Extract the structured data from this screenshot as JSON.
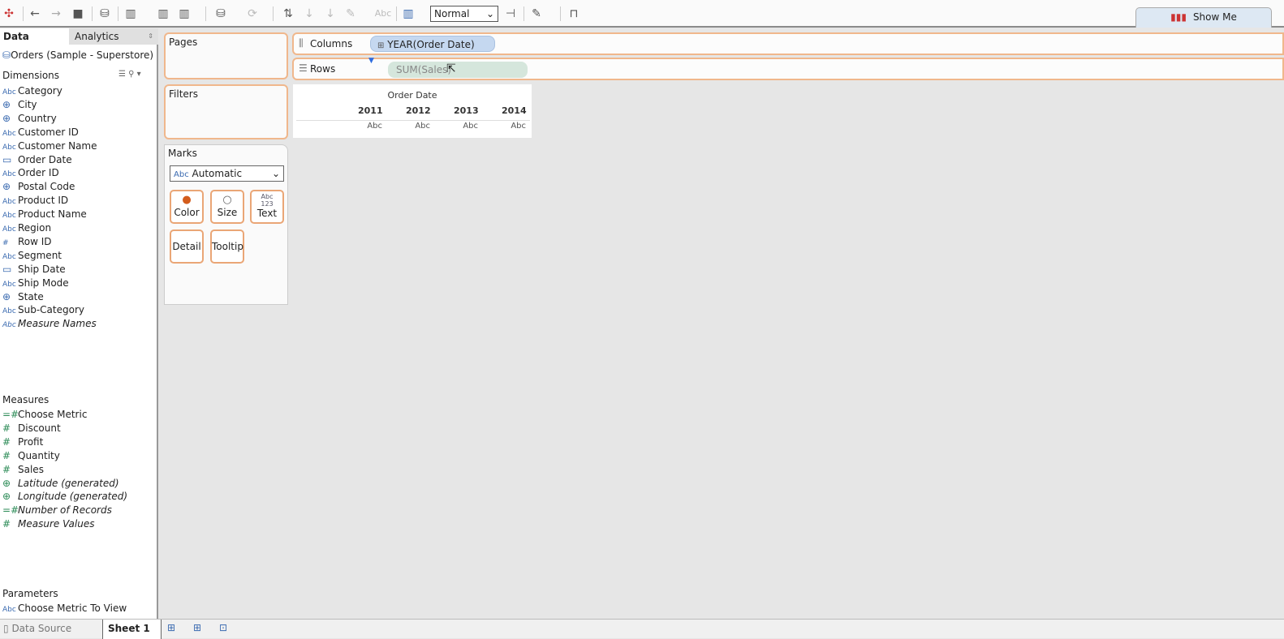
{
  "toolbar": {
    "mark_size_select": "Normal",
    "show_me": "Show Me",
    "format_label": "Abc"
  },
  "left_panel": {
    "tabs": [
      "Data",
      "Analytics"
    ],
    "datasource": "Orders (Sample - Superstore)",
    "dimensions_header": "Dimensions",
    "dimensions": [
      {
        "label": "Category",
        "type": "abc"
      },
      {
        "label": "City",
        "type": "geo"
      },
      {
        "label": "Country",
        "type": "geo"
      },
      {
        "label": "Customer ID",
        "type": "abc"
      },
      {
        "label": "Customer Name",
        "type": "abc"
      },
      {
        "label": "Order Date",
        "type": "date"
      },
      {
        "label": "Order ID",
        "type": "abc"
      },
      {
        "label": "Postal Code",
        "type": "geo"
      },
      {
        "label": "Product ID",
        "type": "abc"
      },
      {
        "label": "Product Name",
        "type": "abc"
      },
      {
        "label": "Region",
        "type": "abc"
      },
      {
        "label": "Row ID",
        "type": "num"
      },
      {
        "label": "Segment",
        "type": "abc"
      },
      {
        "label": "Ship Date",
        "type": "date"
      },
      {
        "label": "Ship Mode",
        "type": "abc"
      },
      {
        "label": "State",
        "type": "geo"
      },
      {
        "label": "Sub-Category",
        "type": "abc"
      },
      {
        "label": "Measure Names",
        "type": "abc",
        "italic": true
      }
    ],
    "measures_header": "Measures",
    "measures": [
      {
        "label": "Choose Metric",
        "type": "calc"
      },
      {
        "label": "Discount",
        "type": "num"
      },
      {
        "label": "Profit",
        "type": "num"
      },
      {
        "label": "Quantity",
        "type": "num"
      },
      {
        "label": "Sales",
        "type": "num"
      },
      {
        "label": "Latitude (generated)",
        "type": "geo",
        "italic": true
      },
      {
        "label": "Longitude (generated)",
        "type": "geo",
        "italic": true
      },
      {
        "label": "Number of Records",
        "type": "calc",
        "italic": true
      },
      {
        "label": "Measure Values",
        "type": "num",
        "italic": true
      }
    ],
    "parameters_header": "Parameters",
    "parameters": [
      {
        "label": "Choose Metric To View",
        "type": "abc"
      }
    ]
  },
  "cards": {
    "pages": "Pages",
    "filters": "Filters",
    "marks": "Marks",
    "mark_type": "Automatic",
    "mark_type_icon": "Abc",
    "buttons": [
      "Color",
      "Size",
      "Text",
      "Detail",
      "Tooltip"
    ],
    "text_icon": "Abc\n123"
  },
  "shelves": {
    "columns_label": "Columns",
    "columns_pill": "YEAR(Order Date)",
    "rows_label": "Rows",
    "rows_pill": "SUM(Sales)"
  },
  "view": {
    "header": "Order Date",
    "years": [
      "2011",
      "2012",
      "2013",
      "2014"
    ],
    "cells": [
      "Abc",
      "Abc",
      "Abc",
      "Abc"
    ]
  },
  "bottom": {
    "data_source": "Data Source",
    "sheet": "Sheet 1"
  },
  "colors": {
    "accent_border": "#f0b78c",
    "dim_pill": "#c5d8f0",
    "measure_pill": "#d5e6dc"
  }
}
